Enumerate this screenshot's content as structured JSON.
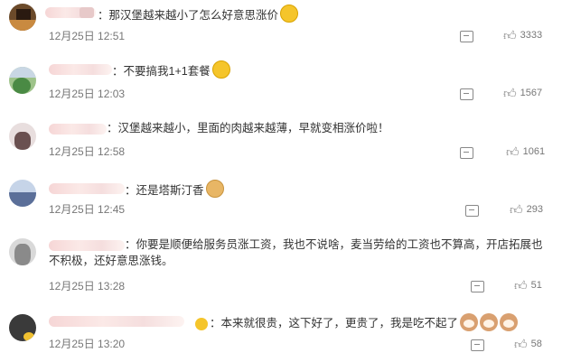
{
  "comments": [
    {
      "text": "：那汉堡越来越小了怎么好意思涨价",
      "date": "12月25日 12:51",
      "likes": "3333",
      "emoji": "smirk-emoji"
    },
    {
      "text": "：不要搞我1+1套餐",
      "date": "12月25日 12:03",
      "likes": "1567",
      "emoji": "crying-emoji"
    },
    {
      "text": "：汉堡越来越小，里面的肉越来越薄，早就变相涨价啦！",
      "date": "12月25日 12:58",
      "likes": "1061"
    },
    {
      "text": "：还是塔斯汀香",
      "date": "12月25日 12:45",
      "likes": "293",
      "emoji": "doge-emoji"
    },
    {
      "text": "：你要是顺便给服务员涨工资，我也不说啥，麦当劳给的工资也不算高，开店拓展也不积极，还好意思涨钱。",
      "date": "12月25日 13:28",
      "likes": "51"
    },
    {
      "text": "：本来就很贵，这下好了，更贵了，我是吃不起了",
      "date": "12月25日 13:20",
      "likes": "58",
      "emoji": "cat-emoji"
    }
  ],
  "colors": {
    "text": "#333333",
    "meta": "#777777",
    "icon": "#888888"
  }
}
